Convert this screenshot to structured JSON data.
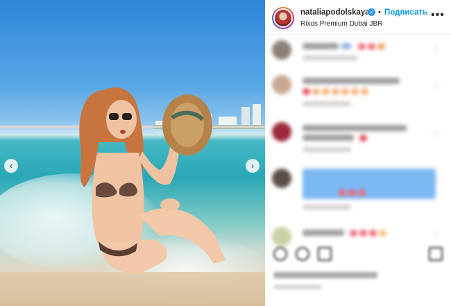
{
  "post": {
    "username": "nataliapodolskaya",
    "verified_icon": "verified-badge-icon",
    "separator": "•",
    "follow_label": "Подписать",
    "location": "Rixos Premium Dubai JBR",
    "more_icon": "more-options-icon"
  },
  "carousel": {
    "prev_glyph": "‹",
    "next_glyph": "›"
  },
  "colors": {
    "follow_blue": "#0095f6",
    "verified_blue": "#3897f0",
    "heart_red": "#ed4956"
  },
  "comments": {
    "blurred": true,
    "count_visible": 5
  },
  "actions": {
    "icons": [
      "like-icon",
      "comment-icon",
      "share-icon",
      "save-icon"
    ]
  }
}
